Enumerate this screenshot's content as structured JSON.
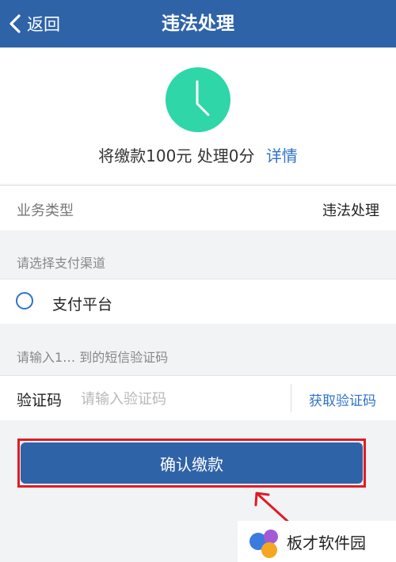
{
  "header": {
    "back_label": "返回",
    "title": "违法处理"
  },
  "summary": {
    "payment_text": "将缴款100元",
    "points_text": "处理0分",
    "details_link": "详情"
  },
  "business_type": {
    "label": "业务类型",
    "value": "违法处理"
  },
  "payment": {
    "section_label": "请选择支付渠道",
    "channel_label": "支付平台"
  },
  "sms": {
    "hint": "请输入1… 到的短信验证码"
  },
  "verification": {
    "label": "验证码",
    "placeholder": "请输入验证码",
    "get_code_label": "获取验证码"
  },
  "confirm_label": "确认缴款",
  "watermark": {
    "text": "板才软件园"
  },
  "colors": {
    "primary": "#2f63a8",
    "accent": "#2fd6a8",
    "link": "#2f73c8",
    "highlight": "#e01b24"
  }
}
